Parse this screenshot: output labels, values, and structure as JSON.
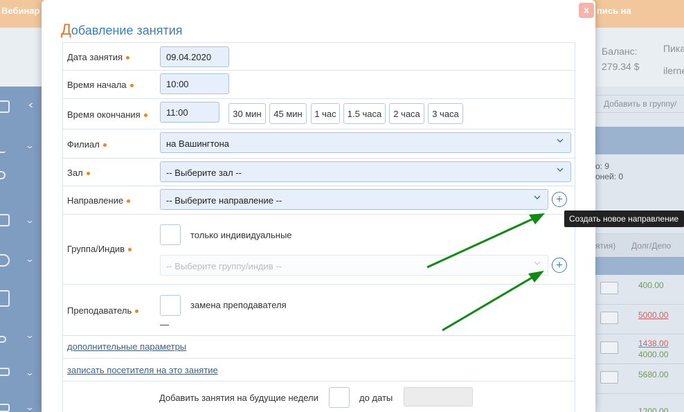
{
  "background": {
    "topbar_left": "Вебинар",
    "topbar_right": "пись на",
    "balance_label": "Баланс:",
    "balance_value": "279.34 $",
    "pik_label": "Пика",
    "ilern_label": "ilerne",
    "add_group_label": "Добавить в группу/",
    "summary_line1": "о: 9",
    "summary_line2": "оней: 0",
    "table_header_col1": "ятия)",
    "table_header_col2": "Долг/Депо",
    "rows": [
      {
        "v1": "400.00",
        "v2": ""
      },
      {
        "v1": "5000.00",
        "v2": ""
      },
      {
        "v1": "1438.00",
        "v2": "4000.00"
      },
      {
        "v1": "5680.00",
        "v2": ""
      },
      {
        "v1": "1200.00",
        "v2": ""
      }
    ]
  },
  "modal": {
    "close_label": "x",
    "title_first": "Д",
    "title_rest": "обавление занятия",
    "date": {
      "label": "Дата занятия",
      "value": "09.04.2020"
    },
    "start_time": {
      "label": "Время начала",
      "value": "10:00"
    },
    "end_time": {
      "label": "Время окончания",
      "value": "11:00",
      "durations": [
        "30 мин",
        "45 мин",
        "1 час",
        "1.5 часа",
        "2 часа",
        "3 часа"
      ]
    },
    "branch": {
      "label": "Филиал",
      "value": "на Вашингтона"
    },
    "hall": {
      "label": "Зал",
      "value": "-- Выберите зал --"
    },
    "direction": {
      "label": "Направление",
      "value": "-- Выберите направление --"
    },
    "group": {
      "label": "Группа/Индив",
      "checkbox_label": "только индивидуальные",
      "placeholder": "-- Выберите группу/индив --"
    },
    "teacher": {
      "label": "Преподаватель",
      "checkbox_label": "замена преподавателя",
      "value": "—"
    },
    "extra_params_link": "дополнительные параметры",
    "enroll_link": "записать посетителя на это занятие",
    "future": {
      "label": "Добавить занятия на будущие недели",
      "until_label": "до даты"
    }
  },
  "tooltip": "Создать новое направление",
  "colors": {
    "accent": "#3a7fbf",
    "required_dot": "#f0861b",
    "arrow": "#0f8a12"
  }
}
